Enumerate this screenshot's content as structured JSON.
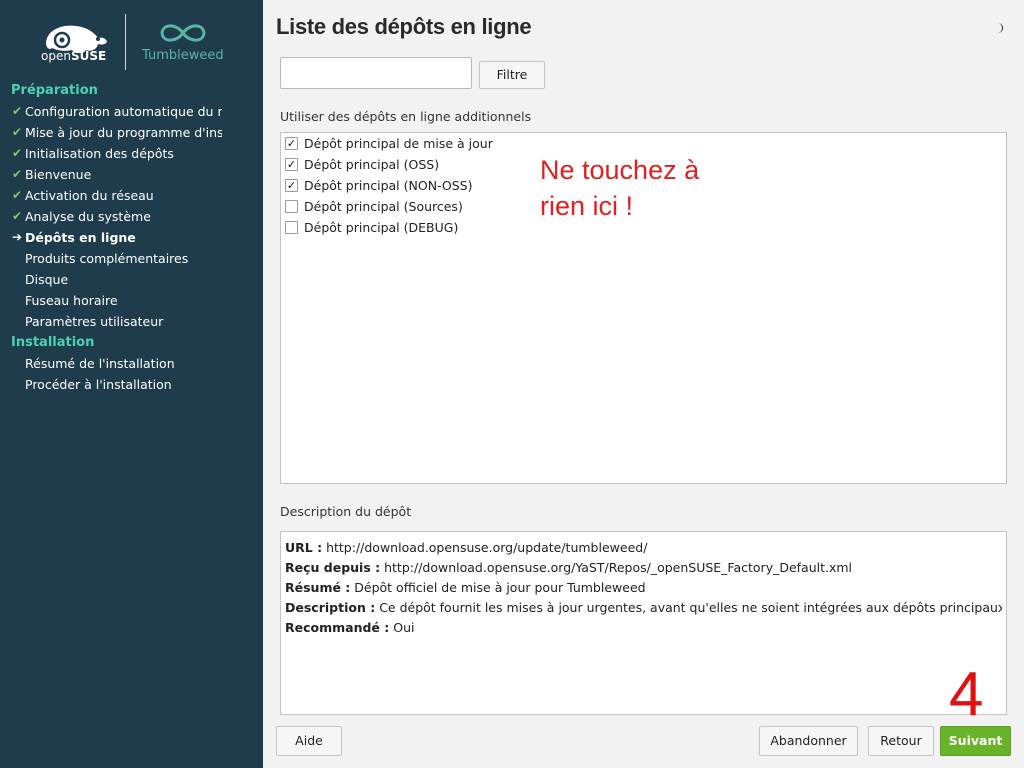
{
  "brand": {
    "opensuse_text_pre": "open",
    "opensuse_text_bold": "SUSE",
    "product_name": "Tumbleweed",
    "accent_color": "#4ed0b4",
    "sidebar_color": "#1f3c4c"
  },
  "sidebar": {
    "sections": [
      {
        "title": "Préparation",
        "steps": [
          {
            "label": "Configuration automatique du réseau",
            "state": "done"
          },
          {
            "label": "Mise à jour du programme d'installation",
            "state": "done"
          },
          {
            "label": "Initialisation des dépôts",
            "state": "done"
          },
          {
            "label": "Bienvenue",
            "state": "done"
          },
          {
            "label": "Activation du réseau",
            "state": "done"
          },
          {
            "label": "Analyse du système",
            "state": "done"
          },
          {
            "label": "Dépôts en ligne",
            "state": "current"
          },
          {
            "label": "Produits complémentaires",
            "state": "pending"
          },
          {
            "label": "Disque",
            "state": "pending"
          },
          {
            "label": "Fuseau horaire",
            "state": "pending"
          },
          {
            "label": "Paramètres utilisateur",
            "state": "pending"
          }
        ]
      },
      {
        "title": "Installation",
        "steps": [
          {
            "label": "Résumé de l'installation",
            "state": "pending"
          },
          {
            "label": "Procéder à l'installation",
            "state": "pending"
          }
        ]
      }
    ]
  },
  "main": {
    "title": "Liste des dépôts en ligne",
    "filter": {
      "value": "",
      "placeholder": "",
      "button_label": "Filtre"
    },
    "repos_label": "Utiliser des dépôts en ligne additionnels",
    "repos": [
      {
        "label": "Dépôt principal de mise à jour",
        "checked": true
      },
      {
        "label": "Dépôt principal (OSS)",
        "checked": true
      },
      {
        "label": "Dépôt principal (NON-OSS)",
        "checked": true
      },
      {
        "label": "Dépôt principal (Sources)",
        "checked": false
      },
      {
        "label": "Dépôt principal (DEBUG)",
        "checked": false
      }
    ],
    "annotation": {
      "line1": "Ne touchez à",
      "line2": "rien ici !",
      "color": "#e02020"
    },
    "description_label": "Description du dépôt",
    "description": [
      {
        "key": "URL :",
        "value": "http://download.opensuse.org/update/tumbleweed/"
      },
      {
        "key": "Reçu depuis :",
        "value": "http://download.opensuse.org/YaST/Repos/_openSUSE_Factory_Default.xml"
      },
      {
        "key": "Résumé :",
        "value": "Dépôt officiel de mise à jour pour Tumbleweed"
      },
      {
        "key": "Description :",
        "value": "Ce dépôt fournit les mises à jour urgentes, avant qu'elles ne soient intégrées aux dépôts principaux."
      },
      {
        "key": "Recommandé :",
        "value": "Oui"
      }
    ]
  },
  "buttons": {
    "help": "Aide",
    "abort": "Abandonner",
    "back": "Retour",
    "next": "Suivant",
    "next_color": "#69b32b"
  },
  "overlay": {
    "step_number": "4"
  },
  "icons": {
    "theme": "half-moon-icon",
    "done": "check-icon",
    "current": "arrow-right-icon"
  }
}
